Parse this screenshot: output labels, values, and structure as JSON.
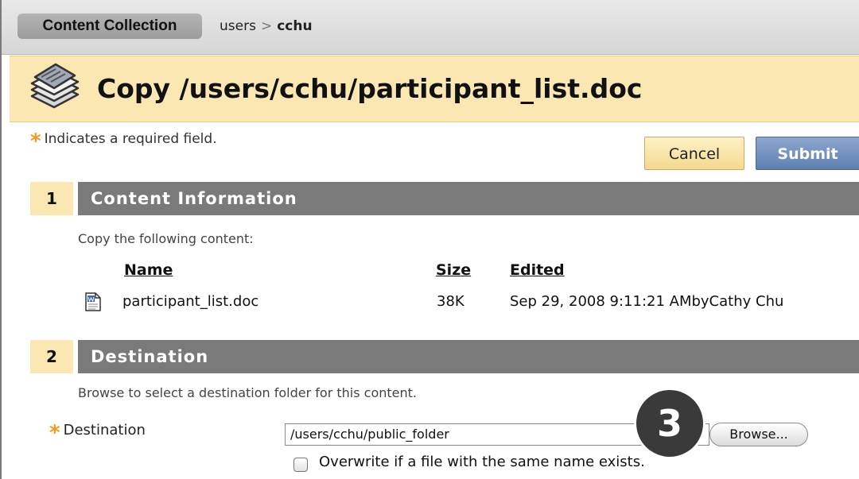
{
  "breadcrumb": {
    "root": "Content Collection",
    "parts": [
      "users",
      "cchu"
    ],
    "separator": ">"
  },
  "page": {
    "title": "Copy /users/cchu/participant_list.doc",
    "title_icon": "stacked-documents-icon"
  },
  "form": {
    "required_star": "*",
    "required_note": "Indicates a required field.",
    "cancel_label": "Cancel",
    "submit_label": "Submit"
  },
  "section1": {
    "number": "1",
    "title": "Content Information",
    "description": "Copy the following content:",
    "columns": {
      "name": "Name",
      "size": "Size",
      "edited": "Edited"
    },
    "item": {
      "icon": "word-document-icon",
      "name": "participant_list.doc",
      "size": "38K",
      "edited": "Sep 29, 2008 9:11:21 AMbyCathy Chu"
    }
  },
  "section2": {
    "number": "2",
    "title": "Destination",
    "description": "Browse to select a destination folder for this content.",
    "destination_label": "Destination",
    "destination_value": "/users/cchu/public_folder",
    "browse_label": "Browse...",
    "overwrite_label": "Overwrite if a file with the same name exists."
  },
  "callout": {
    "step": "3"
  },
  "colors": {
    "accent_yellow": "#fbe7b2",
    "section_gray": "#7a7a7a",
    "submit_blue": "#5e7fb0",
    "required_orange": "#f39a1d"
  }
}
